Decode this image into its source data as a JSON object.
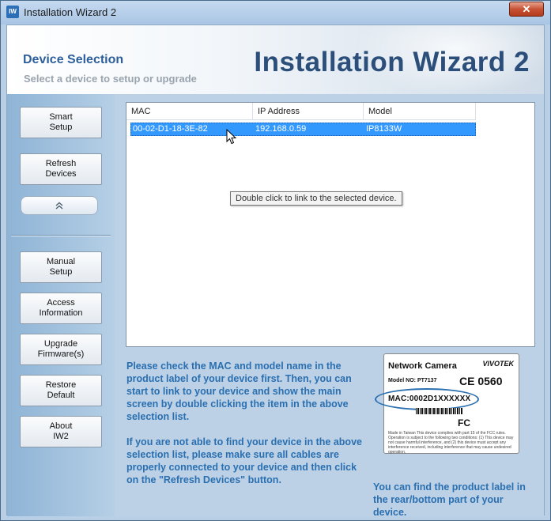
{
  "window": {
    "title": "Installation Wizard 2",
    "icon": "camera-app-icon",
    "close_label": "✕"
  },
  "header": {
    "title": "Device Selection",
    "subtitle": "Select a device to setup or upgrade",
    "brand": "Installation Wizard 2"
  },
  "sidebar": {
    "buttons_top": [
      {
        "label": "Smart\nSetup"
      },
      {
        "label": "Refresh\nDevices"
      }
    ],
    "collapse_icon": "chevron-up-icon",
    "buttons_bottom": [
      {
        "label": "Manual\nSetup"
      },
      {
        "label": "Access\nInformation"
      },
      {
        "label": "Upgrade\nFirmware(s)"
      },
      {
        "label": "Restore\nDefault"
      },
      {
        "label": "About\nIW2"
      }
    ]
  },
  "device_list": {
    "columns": [
      "MAC",
      "IP Address",
      "Model"
    ],
    "rows": [
      {
        "mac": "00-02-D1-18-3E-82",
        "ip": "192.168.0.59",
        "model": "IP8133W",
        "selected": true
      }
    ],
    "tooltip": "Double click to link to the selected device."
  },
  "info": {
    "paragraph1": "Please check the MAC and model name in the product label of your device first. Then, you can start to link to your device and show the main screen by double clicking the item in the above selection list.",
    "paragraph2": "If you are not able to find your device in the above selection list, please make sure all cables are properly connected to your device and then click on the \"Refresh Devices\" button."
  },
  "label_card": {
    "title": "Network Camera",
    "brand": "VIVOTEK",
    "model": "Model NO: PT7137",
    "ce": "CE 0560",
    "mac": "MAC:0002D1XXXXXX",
    "fc": "FC",
    "small_text": "Made in Taiwan This device complies with part 15 of the FCC rules. Operation is subject to the following two conditions: (1) This device may not cause harmful interference, and (2) this device must accept any interference received, including interference that may cause undesired operation.",
    "caption": "You can find the product label in the rear/bottom part of your device.",
    "highlight_color": "#2a6fb0"
  },
  "colors": {
    "accent_text": "#2a6fb0",
    "selection": "#3399ff",
    "sidebar": "#8fb4d6"
  }
}
